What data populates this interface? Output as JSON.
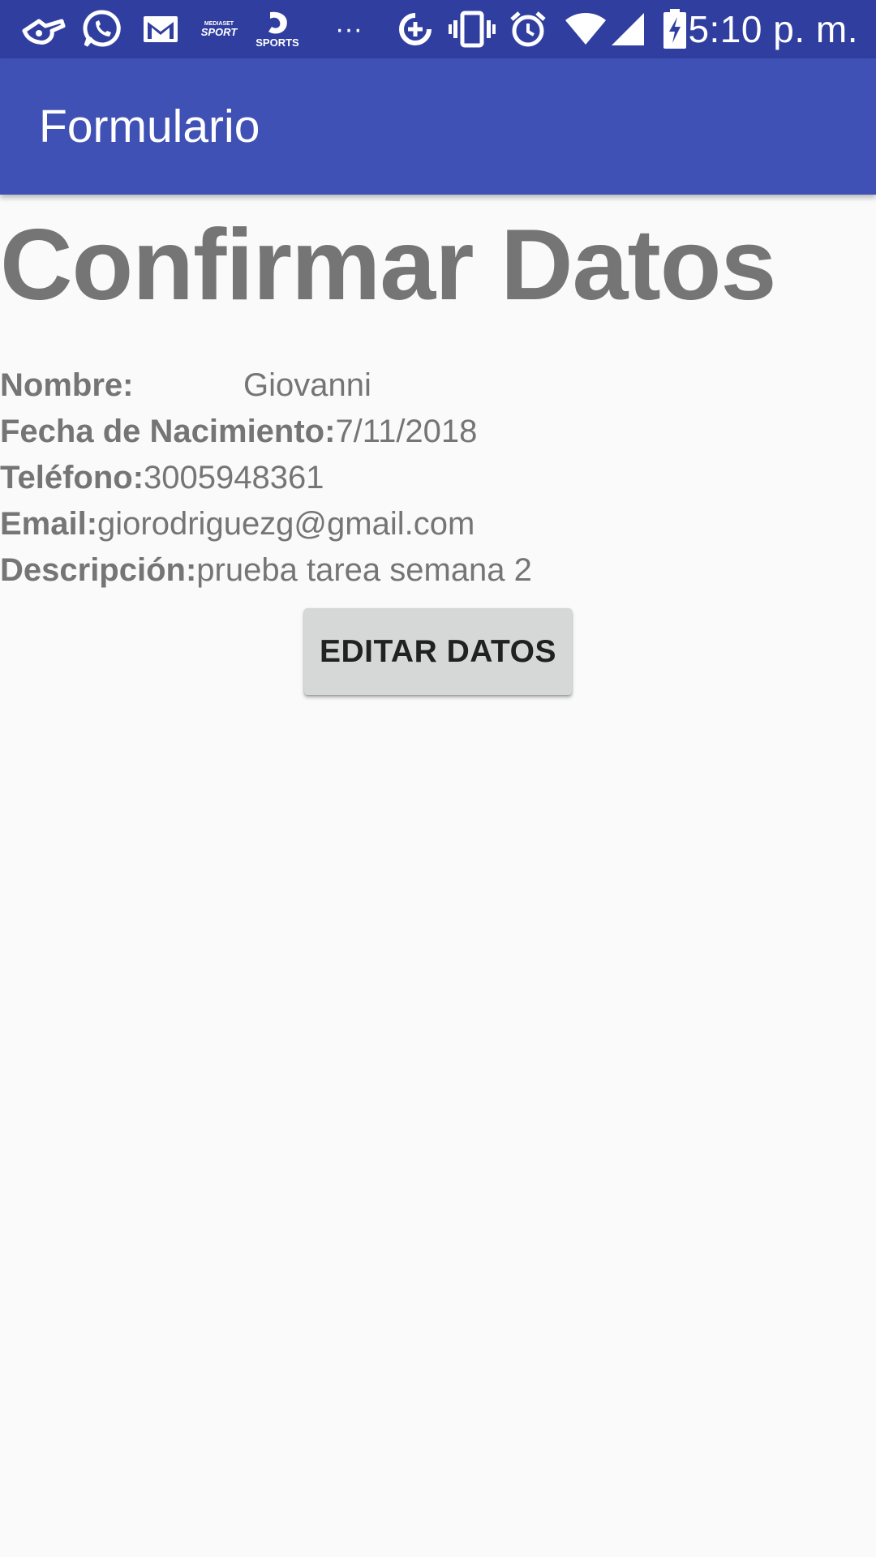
{
  "status_bar": {
    "time": "5:10 p. m.",
    "sport_logo_top": "MEDIASET",
    "sport_logo_main": "SPORT",
    "sports_app_label": "SPORTS",
    "overflow": "···",
    "icons": [
      "whistle-icon",
      "whatsapp-icon",
      "gmail-icon",
      "mediaset-sport-icon",
      "sports-app-icon",
      "more-notifications-icon",
      "data-saver-icon",
      "vibrate-icon",
      "alarm-icon",
      "wifi-icon",
      "signal-icon",
      "battery-charging-icon"
    ],
    "background_color": "#303f9f"
  },
  "app_bar": {
    "title": "Formulario",
    "background_color": "#3f51b5"
  },
  "main": {
    "heading": "Confirmar Datos",
    "fields": [
      {
        "label": "Nombre:",
        "value": "Giovanni"
      },
      {
        "label": "Fecha de Nacimiento:",
        "value": "7/11/2018"
      },
      {
        "label": "Teléfono:",
        "value": "3005948361"
      },
      {
        "label": "Email:",
        "value": "giorodriguezg@gmail.com"
      },
      {
        "label": "Descripción:",
        "value": "prueba tarea semana 2"
      }
    ],
    "edit_button_label": "EDITAR DATOS"
  }
}
